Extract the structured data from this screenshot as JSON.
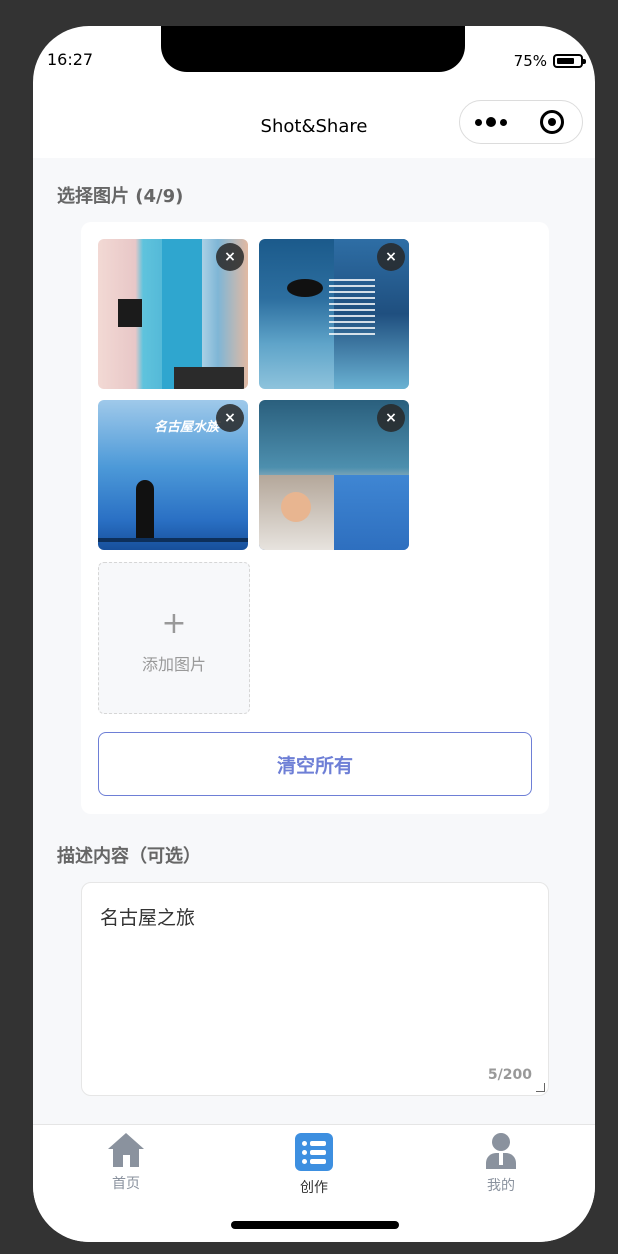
{
  "status": {
    "time": "16:27",
    "battery": "75%",
    "battery_level": 0.75
  },
  "nav": {
    "title": "Shot&Share"
  },
  "images_section": {
    "title": "选择图片 (4/9)",
    "thumb_caption_3": "名古屋水族",
    "remove_label": "×",
    "add_plus": "+",
    "add_label": "添加图片",
    "clear_label": "清空所有"
  },
  "description": {
    "title": "描述内容（可选）",
    "value": "名古屋之旅",
    "counter": "5/200"
  },
  "tabbar": {
    "items": [
      {
        "label": "首页",
        "icon": "home-icon",
        "active": false
      },
      {
        "label": "创作",
        "icon": "list-icon",
        "active": true
      },
      {
        "label": "我的",
        "icon": "user-icon",
        "active": false
      }
    ]
  },
  "colors": {
    "accent": "#6e7fd6",
    "tab_active_icon": "#3d8fe0",
    "tab_inactive": "#8a929e",
    "background": "#f7f8fa"
  }
}
